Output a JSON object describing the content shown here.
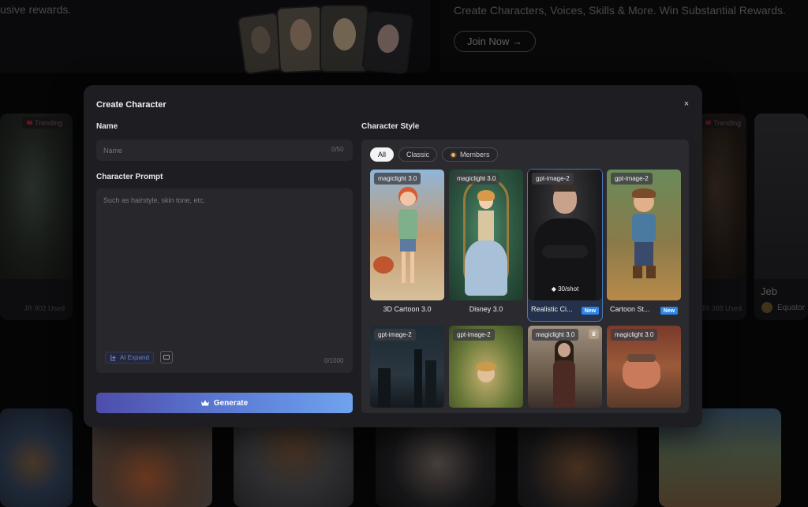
{
  "background": {
    "banner_left_text": "usive rewards.",
    "banner_right_text": "Create Characters, Voices, Skills & More. Win Substantial Rewards.",
    "join_button": "Join Now →",
    "trending_label": "Trending",
    "used_left": "JR 902 Used",
    "used_right": "JR 388 Used",
    "right_card_name": "Jeb",
    "right_card_author": "Equator"
  },
  "modal": {
    "title": "Create Character",
    "close_icon": "×",
    "name_label": "Name",
    "name_placeholder": "Name",
    "name_count": "0/50",
    "prompt_label": "Character Prompt",
    "prompt_placeholder": "Such as hairstyle, skin tone, etc.",
    "prompt_count": "0/1000",
    "ai_expand": "AI Expand",
    "generate": "Generate",
    "style_label": "Character Style",
    "filters": [
      "All",
      "Classic",
      "Members"
    ],
    "active_filter": "All",
    "styles": [
      {
        "tag": "magiclight 3.0",
        "name": "3D Cartoon 3.0",
        "new": false
      },
      {
        "tag": "magiclight 3.0",
        "name": "Disney 3.0",
        "new": false
      },
      {
        "tag": "gpt-image-2",
        "name": "Realistic Ci...",
        "new": true,
        "price": "30/shot",
        "selected": true
      },
      {
        "tag": "gpt-image-2",
        "name": "Cartoon St...",
        "new": true
      },
      {
        "tag": "gpt-image-2"
      },
      {
        "tag": "gpt-image-2"
      },
      {
        "tag": "magiclight 3.0",
        "members": true
      },
      {
        "tag": "magiclight 3.0"
      }
    ],
    "new_badge": "New"
  },
  "colors": {
    "accent": "#4a76b8",
    "new_badge": "#2d86e8",
    "generate_start": "#4e4daa",
    "generate_end": "#6fa3ee"
  }
}
